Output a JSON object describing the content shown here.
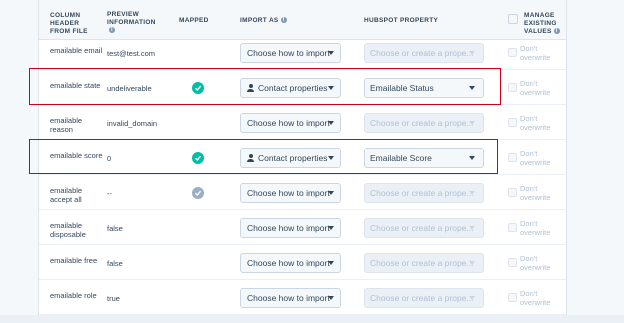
{
  "headers": {
    "column": "COLUMN HEADER FROM FILE",
    "preview": "PREVIEW INFORMATION",
    "mapped": "MAPPED",
    "import_as": "IMPORT AS",
    "hubspot": "HUBSPOT PROPERTY",
    "manage": "MANAGE EXISTING VALUES"
  },
  "colors": {
    "highlight": "#d0021b",
    "mapped_ok": "#00bda5",
    "mapped_off": "#99afc4"
  },
  "rows": [
    {
      "name": "emailable email",
      "preview": "test@test.com",
      "mapped": "none",
      "import_as": "Choose how to import",
      "property": "Choose or create a prope...",
      "overwrite": "Don't overwrite"
    },
    {
      "name": "emailable state",
      "preview": "undeliverable",
      "mapped": "ok",
      "import_as": "Contact properties",
      "property": "Emailable Status",
      "overwrite": "Don't overwrite"
    },
    {
      "name": "emailable reason",
      "preview": "invalid_domain",
      "mapped": "none",
      "import_as": "Choose how to import",
      "property": "Choose or create a prope...",
      "overwrite": "Don't overwrite"
    },
    {
      "name": "emailable score",
      "preview": "0",
      "mapped": "ok",
      "import_as": "Contact properties",
      "property": "Emailable Score",
      "overwrite": "Don't overwrite"
    },
    {
      "name": "emailable accept all",
      "preview": "--",
      "mapped": "off",
      "import_as": "Choose how to import",
      "property": "Choose or create a prope...",
      "overwrite": "Don't overwrite"
    },
    {
      "name": "emailable disposable",
      "preview": "false",
      "mapped": "none",
      "import_as": "Choose how to import",
      "property": "Choose or create a prope...",
      "overwrite": "Don't overwrite"
    },
    {
      "name": "emailable free",
      "preview": "false",
      "mapped": "none",
      "import_as": "Choose how to import",
      "property": "Choose or create a prope...",
      "overwrite": "Don't overwrite"
    },
    {
      "name": "emailable role",
      "preview": "true",
      "mapped": "none",
      "import_as": "Choose how to import",
      "property": "Choose or create a prope...",
      "overwrite": "Don't overwrite"
    }
  ]
}
